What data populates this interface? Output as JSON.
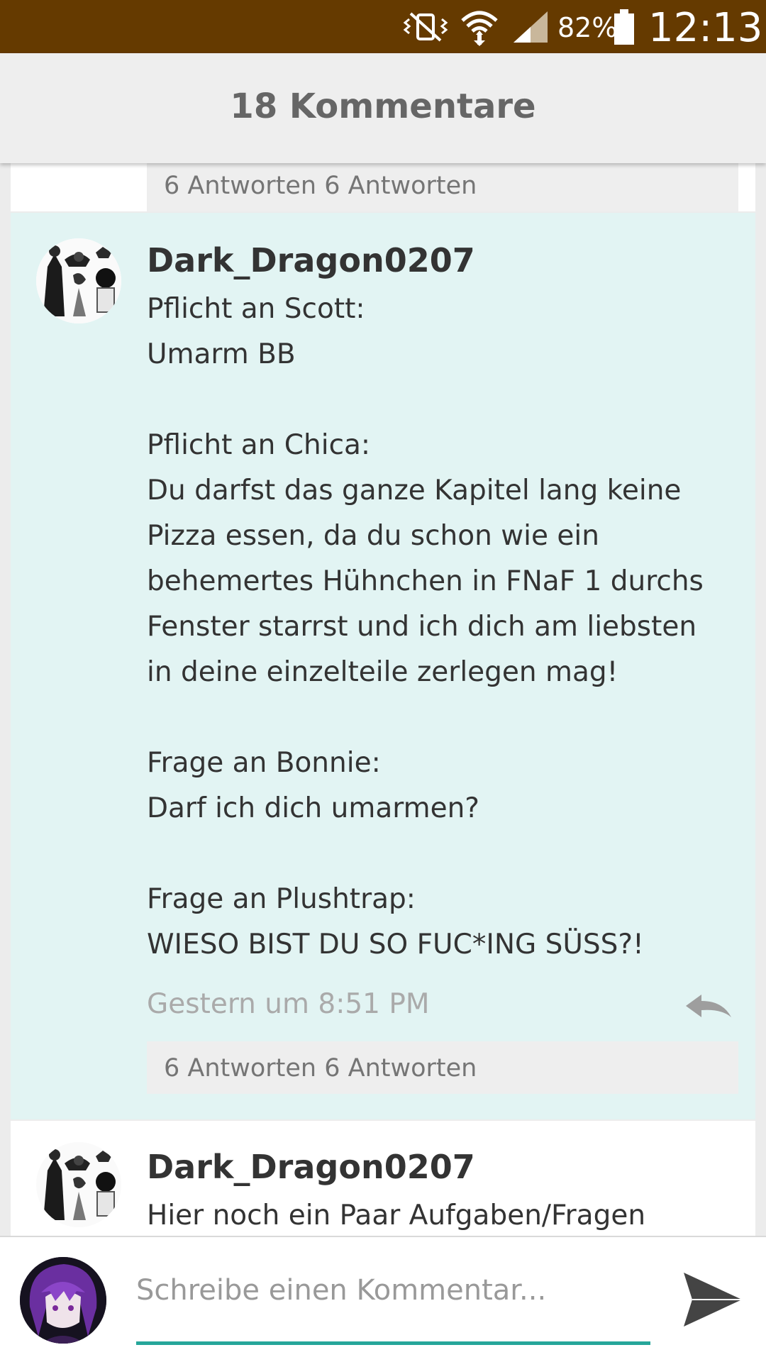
{
  "status_bar": {
    "battery_percent": "82%",
    "time": "12:13",
    "icons": [
      "vibrate-mute-icon",
      "wifi-icon",
      "signal-icon",
      "battery-icon"
    ],
    "background": "#653a00"
  },
  "header": {
    "title": "18 Kommentare"
  },
  "comments": [
    {
      "replies_label": "6 Antworten 6 Antworten"
    },
    {
      "username": "Dark_Dragon0207",
      "text": "Pflicht an Scott:\nUmarm BB\n\nPflicht an Chica:\nDu darfst das ganze Kapitel lang keine Pizza essen, da du schon wie ein behemertes Hühnchen in FNaF 1 durchs Fenster starrst und ich dich am liebsten in deine einzelteile zerlegen mag!\n\nFrage an Bonnie:\nDarf ich dich umarmen?\n\nFrage an Plushtrap:\nWIESO BIST DU SO FUC*ING SÜSS?!",
      "timestamp": "Gestern um 8:51 PM",
      "replies_label": "6 Antworten 6 Antworten",
      "highlight_color": "#e2f4f3"
    },
    {
      "username": "Dark_Dragon0207",
      "text": "Hier noch ein Paar Aufgaben/Fragen"
    }
  ],
  "composer": {
    "placeholder": "Schreibe einen Kommentar...",
    "accent_color": "#26a69a"
  }
}
